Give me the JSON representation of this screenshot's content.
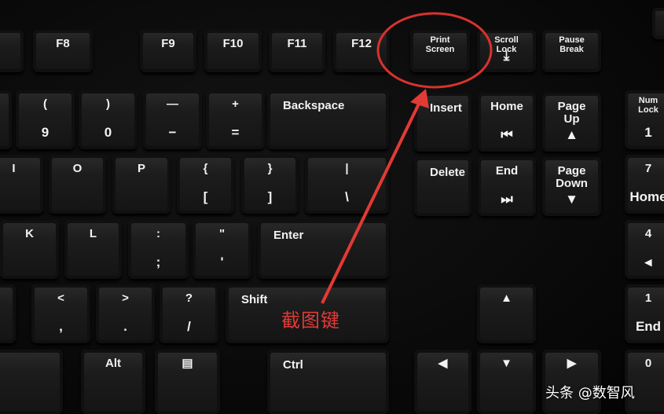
{
  "keys": [
    {
      "top": "F8"
    },
    {
      "top": "F9"
    },
    {
      "top": "F10"
    },
    {
      "top": "F11"
    },
    {
      "top": "F12"
    },
    {
      "top": "Print\nScreen"
    },
    {
      "top": "Scroll\nLock",
      "bot": "⤓"
    },
    {
      "top": "Pause\nBreak"
    },
    {
      "top": "(",
      "bot": "9"
    },
    {
      "top": ")",
      "bot": "0"
    },
    {
      "top": "—",
      "bot": "−"
    },
    {
      "top": "+",
      "bot": "="
    },
    {
      "top": "Backspace"
    },
    {
      "top": "Insert"
    },
    {
      "top": "Home",
      "bot": "⏮"
    },
    {
      "top": "Page\nUp",
      "bot": "▲"
    },
    {
      "top": "Num\nLock",
      "bot": "1"
    },
    {
      "top": "I"
    },
    {
      "top": "O"
    },
    {
      "top": "P"
    },
    {
      "top": "{",
      "bot": "["
    },
    {
      "top": "}",
      "bot": "]"
    },
    {
      "top": "|",
      "bot": "\\"
    },
    {
      "top": "Delete"
    },
    {
      "top": "End",
      "bot": "⏭"
    },
    {
      "top": "Page\nDown",
      "bot": "▼"
    },
    {
      "top": "7",
      "bot": "Home"
    },
    {
      "top": "K"
    },
    {
      "top": "L"
    },
    {
      "top": ":",
      "bot": ";"
    },
    {
      "top": "\"",
      "bot": "'"
    },
    {
      "top": "Enter"
    },
    {
      "top": "4",
      "bot": "◂"
    },
    {
      "top": "<",
      "bot": ","
    },
    {
      "top": ">",
      "bot": "."
    },
    {
      "top": "?",
      "bot": "/"
    },
    {
      "top": "Shift"
    },
    {
      "top": "▲"
    },
    {
      "top": "1",
      "bot": "End"
    },
    {
      "top": "Alt"
    },
    {
      "top": "▤"
    },
    {
      "top": "Ctrl"
    },
    {
      "top": "◀"
    },
    {
      "top": "▼"
    },
    {
      "top": "▶"
    },
    {
      "top": "0"
    },
    {},
    {},
    {},
    {},
    {},
    {}
  ],
  "annotation": {
    "label": "截图键",
    "color": "#e23a35",
    "highlighted_key": "Print Screen"
  },
  "watermark": "头条 @数智风"
}
